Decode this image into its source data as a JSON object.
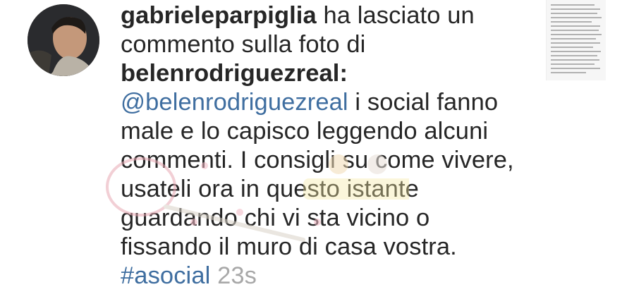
{
  "notification": {
    "username": "gabrieleparpiglia",
    "action_text": " ha lasciato un commento sulla foto di ",
    "photo_owner": "belenrodriguezreal",
    "colon": ":",
    "mention": "@belenrodriguezreal",
    "comment_text": " i social fanno male e lo capisco leggendo alcuni commenti. I consigli su come vivere, usateli ora in questo istante guardando chi vi sta vicino o fissando il muro di casa vostra.",
    "hashtag": "#asocial",
    "timestamp": " 23s"
  },
  "colors": {
    "link": "#3f6ea0",
    "text": "#262626",
    "timestamp": "#a8a8a8"
  }
}
